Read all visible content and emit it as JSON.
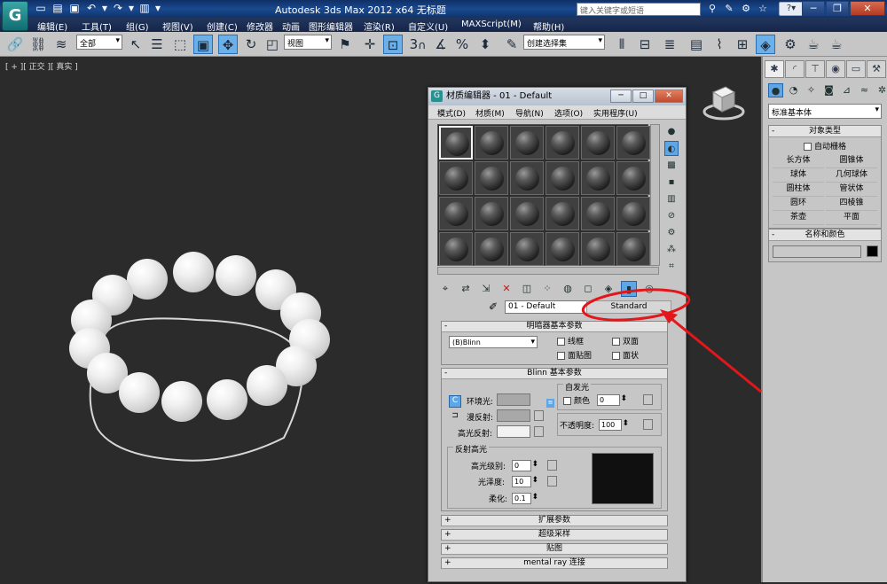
{
  "title_bar": {
    "logo": "G",
    "title": "Autodesk 3ds Max  2012 x64    无标题",
    "search_placeholder": "键入关键字或短语",
    "help_label": "?▾"
  },
  "menu": [
    "编辑(E)",
    "工具(T)",
    "组(G)",
    "视图(V)",
    "创建(C)",
    "修改器",
    "动画",
    "图形编辑器",
    "渲染(R)",
    "自定义(U)",
    "MAXScript(M)",
    "帮助(H)"
  ],
  "toolbar": {
    "selection_filter": "全部",
    "ref_coord": "视图",
    "named_selection": "创建选择集"
  },
  "viewport": {
    "label": "[ + ][ 正交 ][ 真实 ]"
  },
  "command_panel": {
    "category": "标准基本体",
    "object_type": {
      "title": "对象类型",
      "autogrid": "自动栅格",
      "buttons": [
        "长方体",
        "圆锥体",
        "球体",
        "几何球体",
        "圆柱体",
        "管状体",
        "圆环",
        "四棱锥",
        "茶壶",
        "平面"
      ]
    },
    "name_color": {
      "title": "名称和颜色"
    }
  },
  "material_editor": {
    "title": "材质编辑器 - 01 - Default",
    "menu": [
      "模式(D)",
      "材质(M)",
      "导航(N)",
      "选项(O)",
      "实用程序(U)"
    ],
    "material_name": "01 - Default",
    "material_type": "Standard",
    "shader_basic": {
      "title": "明暗器基本参数",
      "shader": "(B)Blinn",
      "options": [
        "线框",
        "双面",
        "面贴图",
        "面状"
      ]
    },
    "blinn_basic": {
      "title": "Blinn 基本参数",
      "ambient": "环境光:",
      "diffuse": "漫反射:",
      "specular": "高光反射:",
      "self_illum": "自发光",
      "color_label": "颜色",
      "color_value": "0",
      "opacity": "不透明度:",
      "opacity_value": "100",
      "spec_highlights": "反射高光",
      "spec_level": "高光级别:",
      "spec_level_value": "0",
      "glossiness": "光泽度:",
      "glossiness_value": "10",
      "soften": "柔化:",
      "soften_value": "0.1"
    },
    "rollouts": [
      "扩展参数",
      "超级采样",
      "贴图",
      "mental ray 连接"
    ]
  },
  "colors": {
    "annotation": "#e3161b",
    "selection": "#6cb0e9"
  }
}
